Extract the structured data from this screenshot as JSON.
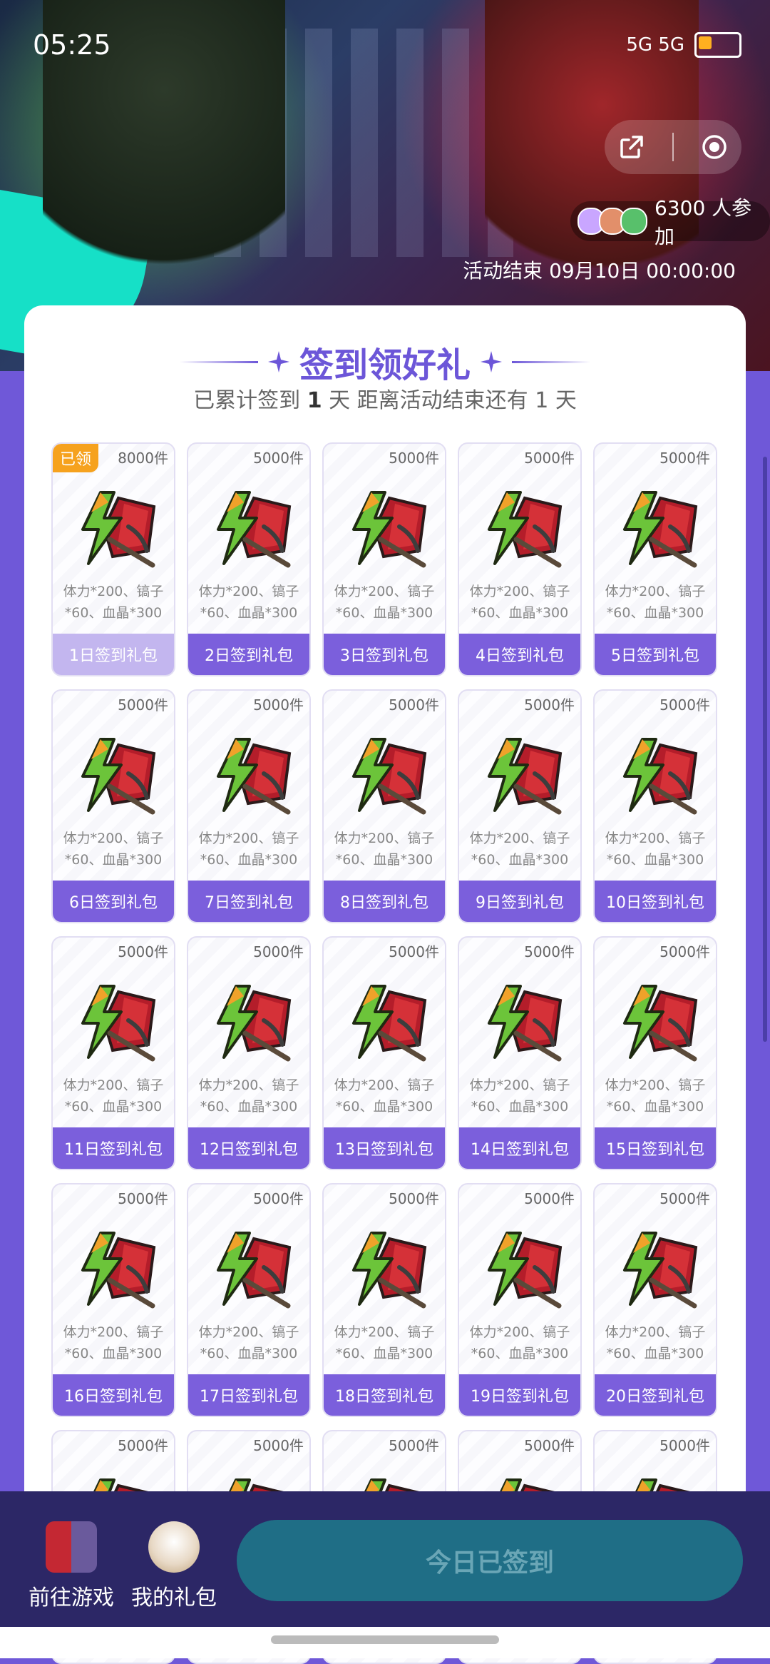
{
  "status_bar": {
    "time": "05:25",
    "signal_text": "5G 5G",
    "battery_icon": "battery-icon"
  },
  "hero": {
    "participants": {
      "count_text": "6300 人参加"
    },
    "end_time": "活动结束 09月10日 00:00:00",
    "share_icon": "share-icon",
    "record_icon": "record-icon"
  },
  "panel": {
    "title": "签到领好礼",
    "subtitle_pre": "已累计签到",
    "signed_days": "1",
    "subtitle_mid": "天  距离活动结束还有 1 天"
  },
  "cards": [
    {
      "qty": "8000件",
      "desc1": "体力*200、镐子",
      "desc2": "*60、血晶*300",
      "label": "1日签到礼包",
      "claimed": "已领"
    },
    {
      "qty": "5000件",
      "desc1": "体力*200、镐子",
      "desc2": "*60、血晶*300",
      "label": "2日签到礼包"
    },
    {
      "qty": "5000件",
      "desc1": "体力*200、镐子",
      "desc2": "*60、血晶*300",
      "label": "3日签到礼包"
    },
    {
      "qty": "5000件",
      "desc1": "体力*200、镐子",
      "desc2": "*60、血晶*300",
      "label": "4日签到礼包"
    },
    {
      "qty": "5000件",
      "desc1": "体力*200、镐子",
      "desc2": "*60、血晶*300",
      "label": "5日签到礼包"
    },
    {
      "qty": "5000件",
      "desc1": "体力*200、镐子",
      "desc2": "*60、血晶*300",
      "label": "6日签到礼包"
    },
    {
      "qty": "5000件",
      "desc1": "体力*200、镐子",
      "desc2": "*60、血晶*300",
      "label": "7日签到礼包"
    },
    {
      "qty": "5000件",
      "desc1": "体力*200、镐子",
      "desc2": "*60、血晶*300",
      "label": "8日签到礼包"
    },
    {
      "qty": "5000件",
      "desc1": "体力*200、镐子",
      "desc2": "*60、血晶*300",
      "label": "9日签到礼包"
    },
    {
      "qty": "5000件",
      "desc1": "体力*200、镐子",
      "desc2": "*60、血晶*300",
      "label": "10日签到礼包"
    },
    {
      "qty": "5000件",
      "desc1": "体力*200、镐子",
      "desc2": "*60、血晶*300",
      "label": "11日签到礼包"
    },
    {
      "qty": "5000件",
      "desc1": "体力*200、镐子",
      "desc2": "*60、血晶*300",
      "label": "12日签到礼包"
    },
    {
      "qty": "5000件",
      "desc1": "体力*200、镐子",
      "desc2": "*60、血晶*300",
      "label": "13日签到礼包"
    },
    {
      "qty": "5000件",
      "desc1": "体力*200、镐子",
      "desc2": "*60、血晶*300",
      "label": "14日签到礼包"
    },
    {
      "qty": "5000件",
      "desc1": "体力*200、镐子",
      "desc2": "*60、血晶*300",
      "label": "15日签到礼包"
    },
    {
      "qty": "5000件",
      "desc1": "体力*200、镐子",
      "desc2": "*60、血晶*300",
      "label": "16日签到礼包"
    },
    {
      "qty": "5000件",
      "desc1": "体力*200、镐子",
      "desc2": "*60、血晶*300",
      "label": "17日签到礼包"
    },
    {
      "qty": "5000件",
      "desc1": "体力*200、镐子",
      "desc2": "*60、血晶*300",
      "label": "18日签到礼包"
    },
    {
      "qty": "5000件",
      "desc1": "体力*200、镐子",
      "desc2": "*60、血晶*300",
      "label": "19日签到礼包"
    },
    {
      "qty": "5000件",
      "desc1": "体力*200、镐子",
      "desc2": "*60、血晶*300",
      "label": "20日签到礼包"
    },
    {
      "qty": "5000件"
    },
    {
      "qty": "5000件"
    },
    {
      "qty": "5000件"
    },
    {
      "qty": "5000件"
    },
    {
      "qty": "5000件"
    }
  ],
  "bottom_bar": {
    "go_game_label": "前往游戏",
    "my_gifts_label": "我的礼包",
    "checkin_button_label": "今日已签到"
  },
  "colors": {
    "accent": "#6c56d8",
    "card_label_bg": "#7b5fdc",
    "claimed_badge": "#f6a21e",
    "button_bg": "#1f6e86"
  }
}
